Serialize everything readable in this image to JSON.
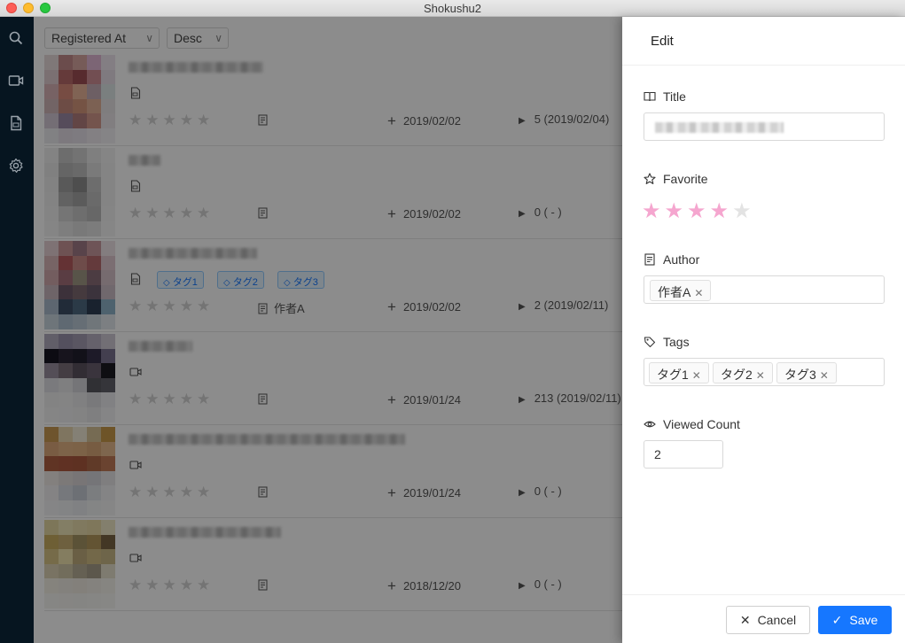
{
  "window": {
    "title": "Shokushu2"
  },
  "sidebar": {
    "items": [
      {
        "icon": "search-icon"
      },
      {
        "icon": "video-icon"
      },
      {
        "icon": "file-icon"
      },
      {
        "icon": "gear-icon"
      }
    ]
  },
  "sort": {
    "field": "Registered At",
    "order": "Desc"
  },
  "list": {
    "rows": [
      {
        "type": "pdf",
        "tags": [],
        "author": "",
        "registered": "2019/02/02",
        "viewed": "5 (2019/02/04)"
      },
      {
        "type": "pdf",
        "tags": [],
        "author": "",
        "registered": "2019/02/02",
        "viewed": "0 ( - )"
      },
      {
        "type": "pdf",
        "tags": [
          "タグ1",
          "タグ2",
          "タグ3"
        ],
        "author": "作者A",
        "registered": "2019/02/02",
        "viewed": "2 (2019/02/11)"
      },
      {
        "type": "video",
        "tags": [],
        "author": "",
        "registered": "2019/01/24",
        "viewed": "213 (2019/02/11)"
      },
      {
        "type": "video",
        "tags": [],
        "author": "",
        "registered": "2019/01/24",
        "viewed": "0 ( - )"
      },
      {
        "type": "video",
        "tags": [],
        "author": "",
        "registered": "2018/12/20",
        "viewed": "0 ( - )"
      }
    ]
  },
  "drawer": {
    "title": "Edit",
    "fields": {
      "title_label": "Title",
      "favorite_label": "Favorite",
      "favorite_value": 4,
      "favorite_max": 5,
      "author_label": "Author",
      "authors": [
        "作者A"
      ],
      "tags_label": "Tags",
      "tags": [
        "タグ1",
        "タグ2",
        "タグ3"
      ],
      "viewed_label": "Viewed Count",
      "viewed_value": "2"
    },
    "cancel_label": "Cancel",
    "save_label": "Save"
  },
  "colors": {
    "primary": "#1677ff",
    "sidebar_bg": "#061520",
    "star_active": "#f5a6cf",
    "tag_bg": "#e6f4ff",
    "tag_text": "#1677ff"
  }
}
